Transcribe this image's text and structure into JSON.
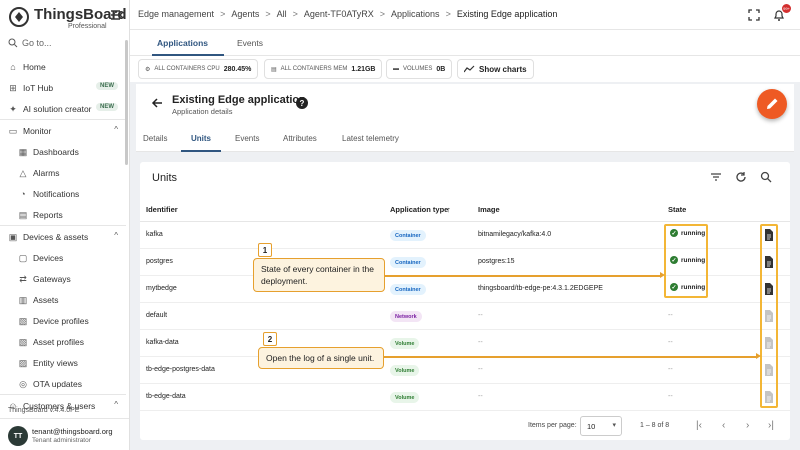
{
  "app": {
    "brand": "ThingsBoard",
    "edition": "Professional",
    "version": "ThingsBoard v.4.4.0PE"
  },
  "sidebar": {
    "goto": "Go to...",
    "items": [
      {
        "label": "Home",
        "icon": "home-icon"
      },
      {
        "label": "IoT Hub",
        "icon": "hub-icon",
        "badge": "NEW"
      },
      {
        "label": "AI solution creator",
        "icon": "ai-icon",
        "badge": "NEW"
      },
      {
        "label": "Monitor",
        "icon": "monitor-icon",
        "expanded": true
      },
      {
        "label": "Dashboards",
        "icon": "dashboard-icon",
        "sub": true
      },
      {
        "label": "Alarms",
        "icon": "alarm-icon",
        "sub": true
      },
      {
        "label": "Notifications",
        "icon": "notification-icon",
        "sub": true
      },
      {
        "label": "Reports",
        "icon": "report-icon",
        "sub": true
      },
      {
        "label": "Devices & assets",
        "icon": "devices-icon",
        "expanded": true
      },
      {
        "label": "Devices",
        "icon": "device-icon",
        "sub": true
      },
      {
        "label": "Gateways",
        "icon": "gateway-icon",
        "sub": true
      },
      {
        "label": "Assets",
        "icon": "asset-icon",
        "sub": true
      },
      {
        "label": "Device profiles",
        "icon": "profile-icon",
        "sub": true
      },
      {
        "label": "Asset profiles",
        "icon": "profile-icon",
        "sub": true
      },
      {
        "label": "Entity views",
        "icon": "view-icon",
        "sub": true
      },
      {
        "label": "OTA updates",
        "icon": "ota-icon",
        "sub": true
      },
      {
        "label": "Customers & users",
        "icon": "users-icon",
        "expanded": true
      }
    ],
    "user": {
      "initials": "TT",
      "email": "tenant@thingsboard.org",
      "role": "Tenant administrator"
    }
  },
  "breadcrumb": [
    "Edge management",
    "Agents",
    "All",
    "Agent-TF0ATyRX",
    "Applications",
    "Existing Edge application"
  ],
  "notifications_count": "99+",
  "main_tabs": [
    "Applications",
    "Events"
  ],
  "stats": {
    "cpu_label": "ALL CONTAINERS CPU",
    "cpu_value": "280.45%",
    "mem_label": "ALL CONTAINERS MEM",
    "mem_value": "1.21GB",
    "vol_label": "VOLUMES",
    "vol_value": "0B",
    "charts_button": "Show charts"
  },
  "details": {
    "title": "Existing Edge application",
    "subtitle": "Application details",
    "help": "?"
  },
  "sub_tabs": [
    "Details",
    "Units",
    "Events",
    "Attributes",
    "Latest telemetry"
  ],
  "units": {
    "title": "Units",
    "columns": {
      "identifier": "Identifier",
      "type": "Application type",
      "sort": "↑",
      "image": "Image",
      "state": "State"
    },
    "rows": [
      {
        "id": "kafka",
        "type": "Container",
        "image": "bitnamilegacy/kafka:4.0",
        "state": "running",
        "log": true
      },
      {
        "id": "postgres",
        "type": "Container",
        "image": "postgres:15",
        "state": "running",
        "log": true
      },
      {
        "id": "mytbedge",
        "type": "Container",
        "image": "thingsboard/tb-edge-pe:4.3.1.2EDGEPE",
        "state": "running",
        "log": true
      },
      {
        "id": "default",
        "type": "Network",
        "image": "--",
        "state": "--",
        "log": false
      },
      {
        "id": "kafka-data",
        "type": "Volume",
        "image": "--",
        "state": "--",
        "log": false
      },
      {
        "id": "tb-edge-postgres-data",
        "type": "Volume",
        "image": "--",
        "state": "--",
        "log": false
      },
      {
        "id": "tb-edge-data",
        "type": "Volume",
        "image": "--",
        "state": "--",
        "log": false
      }
    ]
  },
  "callouts": [
    {
      "num": "1",
      "text": "State of every container in the deployment."
    },
    {
      "num": "2",
      "text": "Open the log of a single unit."
    }
  ],
  "pager": {
    "label": "Items per page:",
    "value": "10",
    "range": "1 – 8 of 8"
  },
  "colors": {
    "primary": "#305680",
    "accent": "#ee5a24",
    "highlight": "#f3b636"
  }
}
